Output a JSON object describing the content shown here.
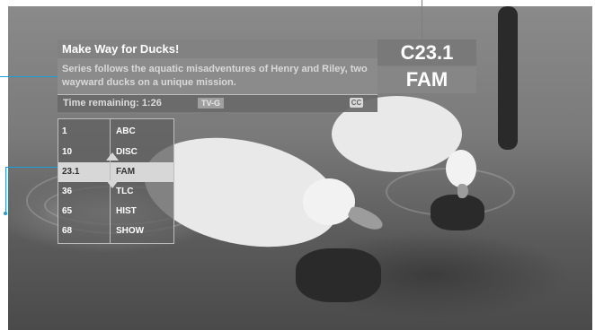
{
  "program": {
    "title": "Make Way for Ducks!",
    "description": "Series follows the aquatic misadventures of Henry and Riley, two wayward ducks on a unique mission.",
    "time_remaining": "Time remaining: 1:26",
    "rating": "TV-G",
    "cc_label": "CC"
  },
  "current_channel": {
    "number": "C23.1",
    "name": "FAM"
  },
  "channel_list": [
    {
      "number": "1",
      "name": "ABC"
    },
    {
      "number": "10",
      "name": "DISC"
    },
    {
      "number": "23.1",
      "name": "FAM",
      "selected": true
    },
    {
      "number": "36",
      "name": "TLC"
    },
    {
      "number": "65",
      "name": "HIST"
    },
    {
      "number": "68",
      "name": "SHOW"
    }
  ],
  "colors": {
    "callout": "#1aa0d8",
    "selected_row": "#d7d7d7"
  }
}
